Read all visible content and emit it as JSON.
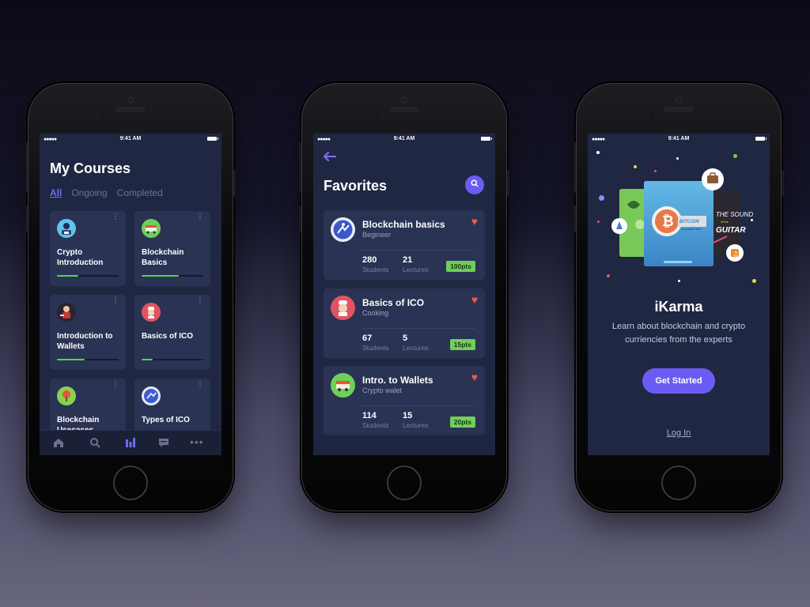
{
  "status": {
    "time": "9:41 AM",
    "signal": "●●●●●"
  },
  "courses_screen": {
    "title": "My Courses",
    "tabs": [
      {
        "label": "All",
        "active": true
      },
      {
        "label": "Ongoing",
        "active": false
      },
      {
        "label": "Completed",
        "active": false
      }
    ],
    "cards": [
      {
        "label": "Crypto Introduction",
        "progress": 0.35,
        "icon": "user-avatar-icon"
      },
      {
        "label": "Blockchain Basics",
        "progress": 0.6,
        "icon": "truck-avatar-icon"
      },
      {
        "label": "Introduction to Wallets",
        "progress": 0.45,
        "icon": "person-avatar-icon"
      },
      {
        "label": "Basics of ICO",
        "progress": 0.18,
        "icon": "chef-avatar-icon"
      },
      {
        "label": "Blockchain Usecases",
        "progress": 0.0,
        "icon": "tree-avatar-icon"
      },
      {
        "label": "Types of ICO",
        "progress": 0.0,
        "icon": "runner-avatar-icon"
      }
    ],
    "tabbar": [
      "home-icon",
      "search-icon",
      "chart-icon",
      "chat-icon",
      "more-icon"
    ]
  },
  "favorites_screen": {
    "title": "Favorites",
    "items": [
      {
        "title": "Blockchain basics",
        "subtitle": "Begineer",
        "students": "280",
        "students_label": "Students",
        "lectures": "21",
        "lectures_label": "Lectures",
        "points": "100pts"
      },
      {
        "title": "Basics of ICO",
        "subtitle": "Cooking",
        "students": "67",
        "students_label": "Students",
        "lectures": "5",
        "lectures_label": "Lectures",
        "points": "15pts"
      },
      {
        "title": "Intro. to Wallets",
        "subtitle": "Crypto walet",
        "students": "114",
        "students_label": "Students",
        "lectures": "15",
        "lectures_label": "Lectures",
        "points": "20pts"
      }
    ]
  },
  "onboarding_screen": {
    "app_name": "iKarma",
    "description": "Learn about blockchain and crypto curriencies from the experts",
    "cta": "Get Started",
    "login": "Log In",
    "illus_texts": {
      "bitcoin": "BITCOIN",
      "bitcoin_small": "accepted here",
      "sound": "THE SOUND",
      "guitar": "GUITAR",
      "of": "of the"
    }
  },
  "colors": {
    "accent": "#6b5cf3",
    "progress": "#56d24a",
    "heart": "#ef5a4e",
    "points": "#6ed05a",
    "screen_bg": "#1f2742",
    "card_bg": "#2a3354"
  }
}
